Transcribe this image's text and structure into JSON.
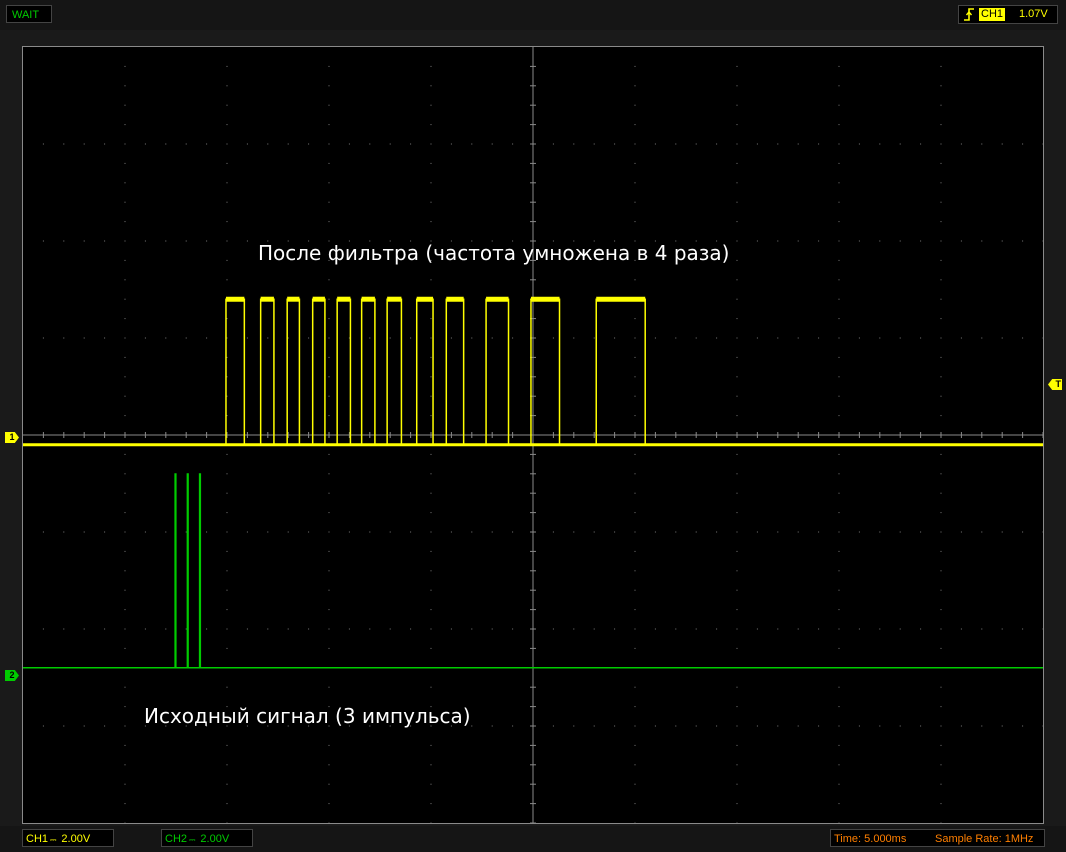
{
  "status": {
    "mode": "WAIT"
  },
  "trigger": {
    "channel": "CH1",
    "level": "1.07V",
    "edge_icon": "rising-edge-icon"
  },
  "annotations": {
    "ch1_label": "После фильтра (частота умножена в 4 раза)",
    "ch2_label": "Исходный сигнал (3 импульса)"
  },
  "markers": {
    "ch1": "1",
    "ch2": "2",
    "trigger": "T"
  },
  "channels": [
    {
      "name": "CH1",
      "coupling_icon": "dc-coupling-icon",
      "scale": "2.00V",
      "color": "#ffff00"
    },
    {
      "name": "CH2",
      "coupling_icon": "dc-coupling-icon",
      "scale": "2.00V",
      "color": "#00cc00"
    }
  ],
  "timebase": {
    "time": "Time: 5.000ms",
    "sample_rate": "Sample Rate: 1MHz",
    "color": "#ff7f00"
  },
  "chart_data": {
    "type": "line",
    "x_unit": "div",
    "y_unit": "div",
    "xlim": [
      0,
      10
    ],
    "ylim": [
      -4,
      4
    ],
    "grid": true,
    "series": [
      {
        "channel": "CH1",
        "color": "#ffff00",
        "baseline_div": -0.1,
        "high_div": 1.4,
        "pulses_div": [
          [
            1.99,
            2.17
          ],
          [
            2.33,
            2.46
          ],
          [
            2.59,
            2.71
          ],
          [
            2.84,
            2.96
          ],
          [
            3.08,
            3.21
          ],
          [
            3.32,
            3.45
          ],
          [
            3.57,
            3.71
          ],
          [
            3.86,
            4.02
          ],
          [
            4.15,
            4.32
          ],
          [
            4.54,
            4.76
          ],
          [
            4.98,
            5.26
          ],
          [
            5.62,
            6.1
          ]
        ]
      },
      {
        "channel": "CH2",
        "color": "#00cc00",
        "baseline_div": -2.4,
        "high_div": -0.4,
        "pulses_div": [
          [
            1.49,
            1.5
          ],
          [
            1.61,
            1.62
          ],
          [
            1.73,
            1.74
          ]
        ]
      }
    ]
  }
}
